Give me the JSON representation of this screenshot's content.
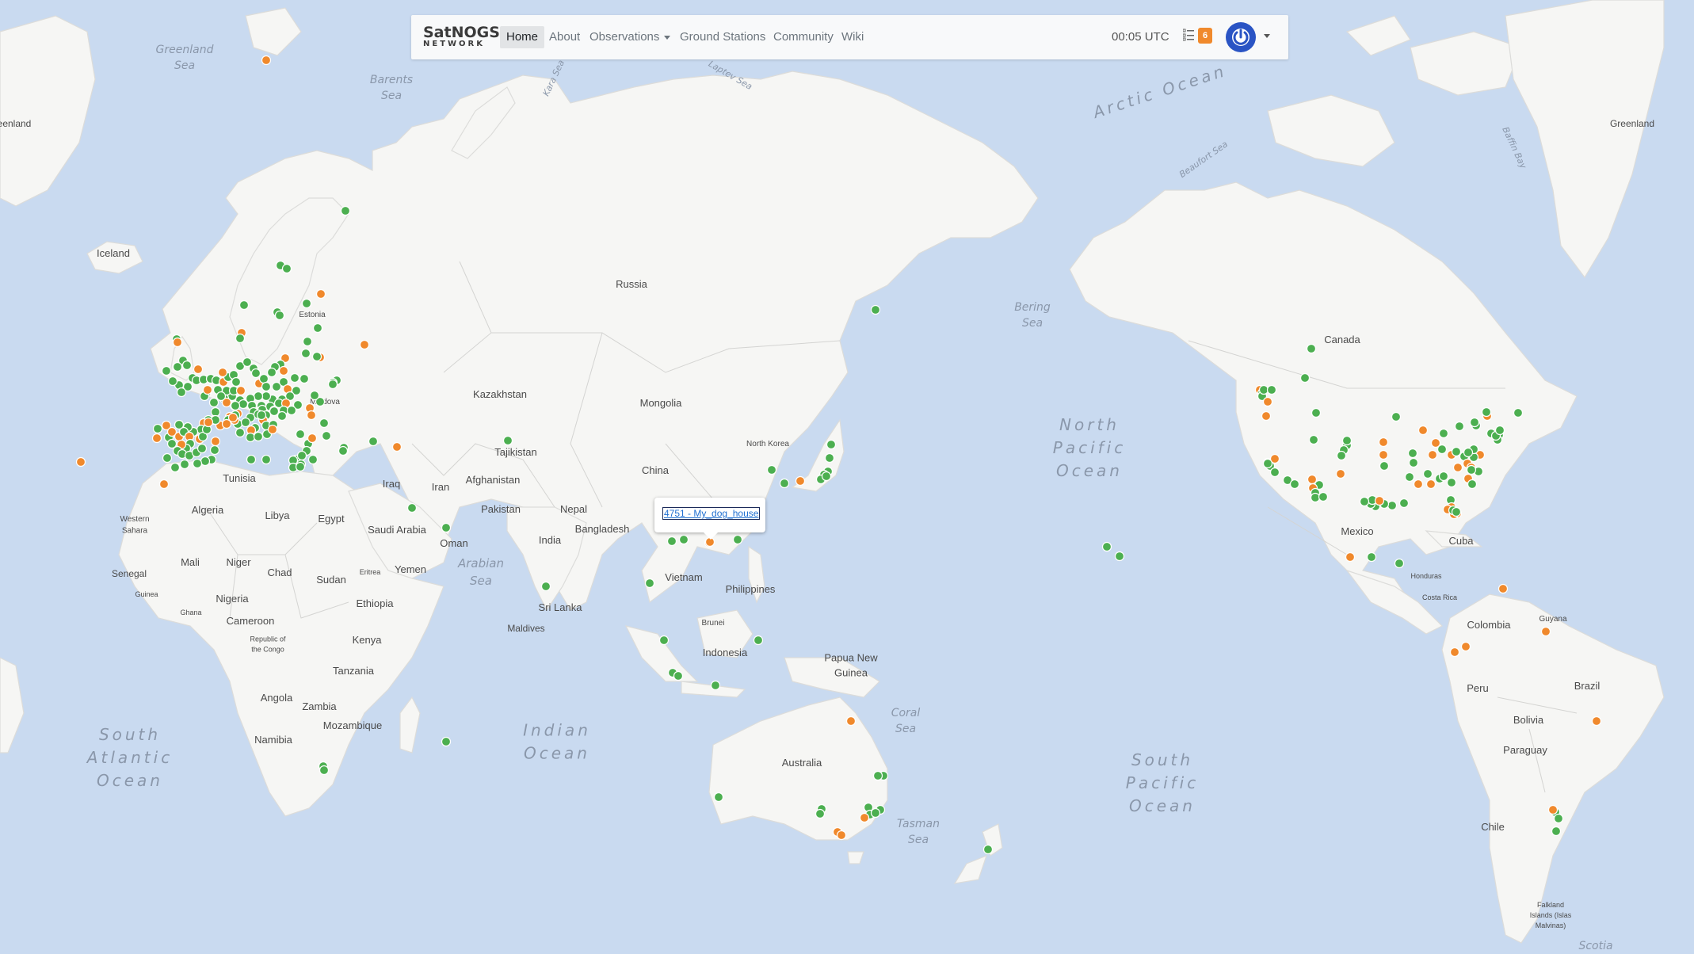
{
  "navbar": {
    "brand_top": "SatNOGS",
    "brand_bottom": "NETWORK",
    "items": [
      {
        "label": "Home",
        "active": true
      },
      {
        "label": "About"
      },
      {
        "label": "Observations",
        "dropdown": true
      },
      {
        "label": "Ground Stations"
      },
      {
        "label": "Community"
      },
      {
        "label": "Wiki"
      }
    ],
    "utc_time": "00:05 UTC",
    "jobs_icon": "list-icon",
    "jobs_badge": "6",
    "user_icon": "power-icon",
    "accent_color": "#2a54c4",
    "badge_color": "#f0892c"
  },
  "tooltip": {
    "link_text": "4751 - My_dog_house"
  },
  "map": {
    "station_colors": {
      "online": "#4caf50",
      "testing": "#f0892c"
    },
    "water_color": "#c9daf0",
    "land_color": "#f6f6f4",
    "country_labels": [
      "Iceland",
      "Russia",
      "Estonia",
      "Moldova",
      "Kazakhstan",
      "Mongolia",
      "Tunisia",
      "Algeria",
      "Libya",
      "Egypt",
      "Western Sahara",
      "Senegal",
      "Mali",
      "Niger",
      "Chad",
      "Sudan",
      "Eritrea",
      "Yemen",
      "Saudi Arabia",
      "Oman",
      "Iraq",
      "Iran",
      "Afghanistan",
      "Tajikistan",
      "Pakistan",
      "Nepal",
      "India",
      "Bangladesh",
      "China",
      "North Korea",
      "Vietnam",
      "Philippines",
      "Brunei",
      "Indonesia",
      "Papua New Guinea",
      "Sri Lanka",
      "Maldives",
      "Nigeria",
      "Guinea",
      "Ghana",
      "Cameroon",
      "Republic of the Congo",
      "Ethiopia",
      "Kenya",
      "Tanzania",
      "Angola",
      "Zambia",
      "Mozambique",
      "Namibia",
      "Australia",
      "Canada",
      "Mexico",
      "Cuba",
      "Honduras",
      "Costa Rica",
      "Colombia",
      "Guyana",
      "Peru",
      "Brazil",
      "Bolivia",
      "Paraguay",
      "Chile",
      "Falkland Islands (Islas Malvinas)",
      "Greenland",
      "eenland"
    ],
    "sea_labels": [
      "Greenland Sea",
      "Barents Sea",
      "Kara Sea",
      "Laptev Sea",
      "Beaufort Sea",
      "Baffin Bay",
      "Bering Sea",
      "Arabian Sea",
      "Coral Sea",
      "Tasman Sea",
      "Scotia"
    ],
    "ocean_labels": [
      "Arctic Ocean",
      "North Pacific Ocean",
      "South Pacific Ocean",
      "Indian Ocean",
      "South Atlantic Ocean"
    ]
  }
}
